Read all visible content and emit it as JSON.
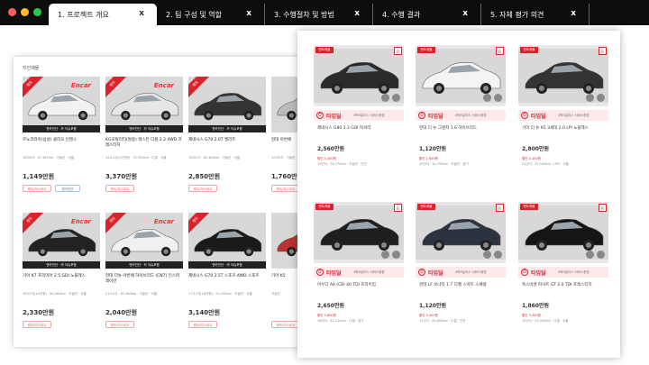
{
  "window": {
    "dots": [
      "#ff5f57",
      "#febc2e",
      "#28c840"
    ]
  },
  "tabs": [
    {
      "label": "1. 프로젝트 개요",
      "close": "x",
      "active": true
    },
    {
      "label": "2. 팀 구성 및 역할",
      "close": "x",
      "active": false
    },
    {
      "label": "3. 수행절차 및 방법",
      "close": "x",
      "active": false
    },
    {
      "label": "4. 수행 결과",
      "close": "x",
      "active": false
    },
    {
      "label": "5. 자체 평가 의견",
      "close": "x",
      "active": false
    }
  ],
  "left_page": {
    "section_title": "지인매물",
    "cards": [
      {
        "ribbon": "렌트",
        "brand": "Encar",
        "banner": "엔카진단 · 카 이슈포함",
        "name": "르노코리아(삼성) 클리오 인텐스",
        "meta": "18/09식 · 57,467km · 가솔린 · 서울",
        "price": "1,149만원",
        "lease": "렌트/리스비교",
        "check": "엔카진단",
        "car_color": "#f2f2f2"
      },
      {
        "ribbon": "렌트",
        "brand": "Encar",
        "banner": "엔카진단 · 카 이슈포함",
        "name": "KG모빌리티(쌍용) 렉스턴 더블 2.2 4WD 프레스티지",
        "meta": "20/11식(21년형) · 70,320km · 디젤 · 서울",
        "price": "3,370만원",
        "lease": "렌트/리스비교",
        "check": "",
        "car_color": "#e6e6e6"
      },
      {
        "ribbon": "렌트",
        "brand": "",
        "banner": "엔카진단 · 카 이슈포함",
        "name": "제네시스 G70 2.0T 엘리트",
        "meta": "19/01식 · 80,469km · 가솔린 · 서울",
        "price": "2,850만원",
        "lease": "렌트/리스비교",
        "check": "",
        "car_color": "#333333"
      },
      {
        "ribbon": "",
        "brand": "",
        "banner": "",
        "name": "현대 아반떼",
        "meta": "20/03식 · 가솔린",
        "price": "1,760만원",
        "lease": "렌트/리스비교",
        "check": "",
        "car_color": "#bbbbbb"
      },
      {
        "ribbon": "렌트",
        "brand": "Encar",
        "banner": "엔카진단 · 카 이슈포함",
        "name": "기아 K7 프리미어 2.5 GDI 노블레스",
        "meta": "19/07식(20년형) · 80,360km · 가솔린 · 서울",
        "price": "2,330만원",
        "lease": "렌트/리스비교",
        "check": "",
        "car_color": "#222222"
      },
      {
        "ribbon": "렌트",
        "brand": "Encar",
        "banner": "엔카진단 · 카 이슈포함",
        "name": "현대 더뉴 아반떼 하이브리드 (CN7) 인스퍼레이션",
        "meta": "21/10식 · 85,360km · 가솔린 · 서울",
        "price": "2,040만원",
        "lease": "렌트/리스비교",
        "check": "",
        "car_color": "#f0f0f0"
      },
      {
        "ribbon": "렌트",
        "brand": "",
        "banner": "엔카진단 · 카 이슈포함",
        "name": "제네시스 G70 2.5T 스포츠 AWD 스포츠",
        "meta": "17/11식(18년형) · 25,100km · 가솔린 · 서울",
        "price": "3,140만원",
        "lease": "렌트/리스비교",
        "check": "",
        "car_color": "#1a1a1a"
      },
      {
        "ribbon": "",
        "brand": "",
        "banner": "",
        "name": "기아 K5",
        "meta": "가솔린",
        "price": "",
        "lease": "렌트/리스비교",
        "check": "",
        "car_color": "#b33"
      }
    ]
  },
  "right_page": {
    "cards": [
      {
        "badge": "렌트매물",
        "badge_r": "R",
        "deal": "타임딜",
        "deal_sub": "4박5일리스 서비스증정",
        "name": "제네시스 G80 3.3 GDI 럭셔리",
        "price": "2,560만원",
        "discount": "할인 3,400원",
        "meta": "19년식 · 76,770km · 가솔린 · 인천",
        "car_color": "#2a2a2a"
      },
      {
        "badge": "렌트매물",
        "badge_r": "R",
        "deal": "타임딜",
        "deal_sub": "4박5일리스 서비스증정",
        "name": "현대 더 뉴 그랜저 1.6 하이브리드",
        "price": "1,120만원",
        "discount": "할인 2,600원",
        "meta": "20년식 · 44,700km · 가솔린 · 경기",
        "car_color": "#f4f4f4"
      },
      {
        "badge": "렌트매물",
        "badge_r": "R",
        "deal": "타임딜",
        "deal_sub": "4박5일리스 서비스증정",
        "name": "기아 더 뉴 K5 3세대 2.0 LPI 노블레스",
        "price": "2,800만원",
        "discount": "할인 4,400원",
        "meta": "21년식 · 32,100km · LPG · 서울",
        "car_color": "#333333"
      },
      {
        "badge": "렌트매물",
        "badge_r": "R",
        "deal": "타임딜",
        "deal_sub": "4박5일리스 서비스증정",
        "name": "아우디 A6 (C8) 40 TDI 프리미엄",
        "price": "2,650만원",
        "discount": "할인 3,800원",
        "meta": "18년식 · 61,210km · 디젤 · 경기",
        "car_color": "#1e1e1e"
      },
      {
        "badge": "렌트매물",
        "badge_r": "R",
        "deal": "타임딜",
        "deal_sub": "4박5일리스 서비스증정",
        "name": "현대 LF 쏘나타 1.7 디젤 스마트 스페셜",
        "price": "1,120만원",
        "discount": "할인 3,400원",
        "meta": "17년식 · 82,600km · 디젤 · 인천",
        "car_color": "#2b3340"
      },
      {
        "badge": "렌트매물",
        "badge_r": "R",
        "deal": "타임딜",
        "deal_sub": "4박5일리스 서비스증정",
        "name": "폭스바겐 파사트 GT 2.0 TDI 프레스티지",
        "price": "1,860만원",
        "discount": "할인 3,300원",
        "meta": "19년식 · 54,430km · 디젤 · 서울",
        "car_color": "#151515"
      }
    ]
  }
}
